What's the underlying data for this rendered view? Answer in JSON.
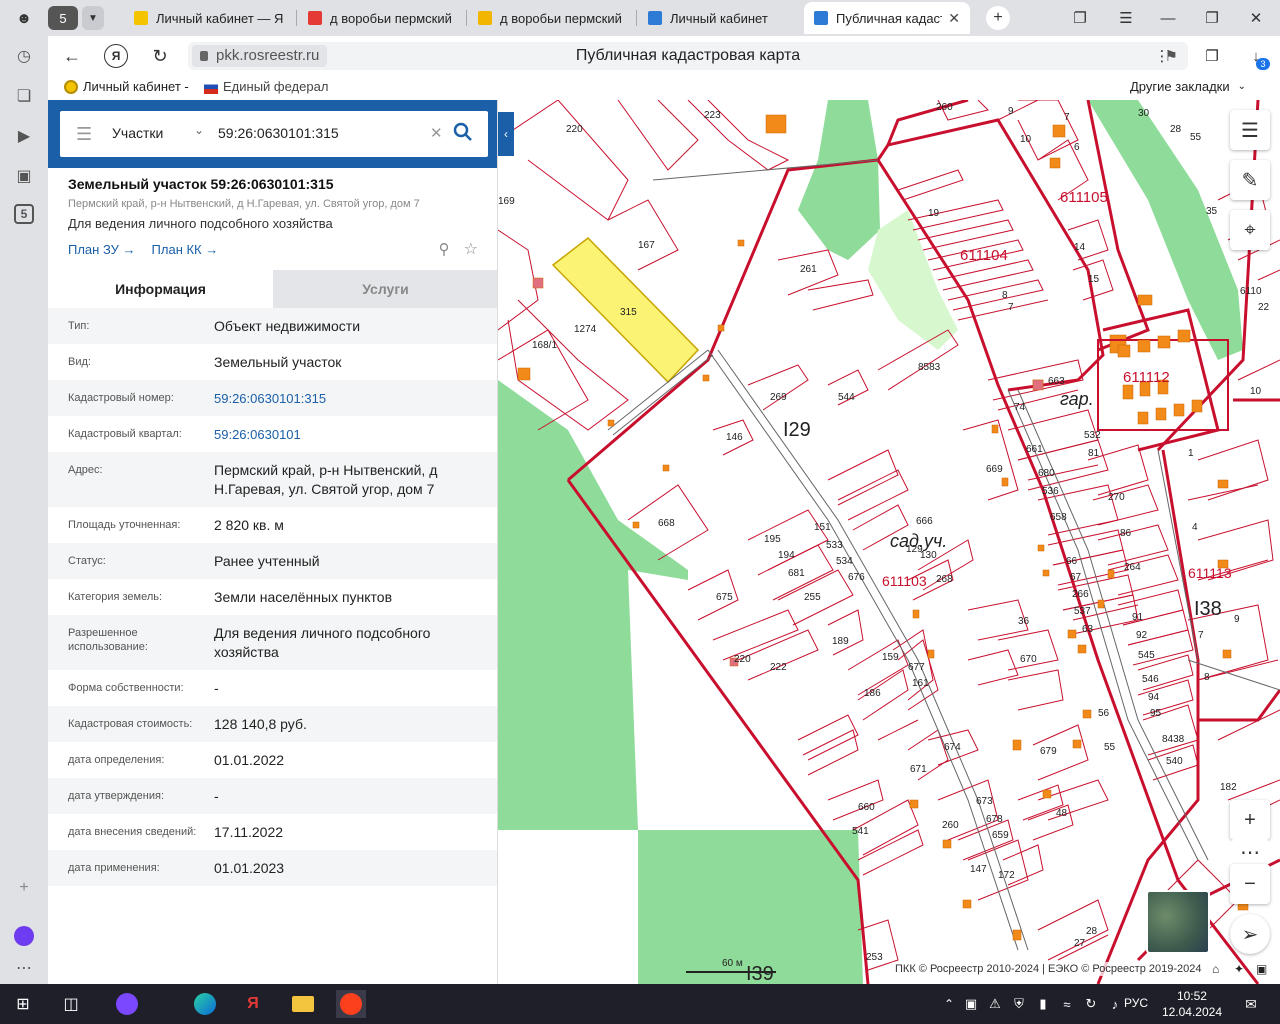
{
  "browser": {
    "tab_count_badge": "5",
    "tabs": [
      {
        "label": "Личный кабинет — Я",
        "color": "#f5c400"
      },
      {
        "label": "д воробьи пермский",
        "color": "#e53935"
      },
      {
        "label": "д воробьи пермский",
        "color": "#f2b600"
      },
      {
        "label": "Личный кабинет",
        "color": "#2e7bd6"
      },
      {
        "label": "Публичная кадаст",
        "color": "#2e7bd6"
      }
    ],
    "url": "pkk.rosreestr.ru",
    "page_title": "Публичная кадастровая карта",
    "downloads_badge": "3",
    "bookmarks": [
      {
        "label": "Личный кабинет -"
      },
      {
        "label": "Единый федерал"
      }
    ],
    "other_bookmarks": "Другие закладки",
    "rail_badge": "5"
  },
  "search": {
    "category": "Участки",
    "query": "59:26:0630101:315"
  },
  "card": {
    "title": "Земельный участок 59:26:0630101:315",
    "address": "Пермский край, р-н Нытвенский, д Н.Гаревая, ул. Святой угор, дом 7",
    "usage": "Для ведения личного подсобного хозяйства",
    "link_zu": "План ЗУ →",
    "link_kk": "План КК →"
  },
  "tabs": {
    "info": "Информация",
    "services": "Услуги"
  },
  "info_rows": [
    {
      "label": "Тип:",
      "value": "Объект недвижимости"
    },
    {
      "label": "Вид:",
      "value": "Земельный участок"
    },
    {
      "label": "Кадастровый номер:",
      "value": "59:26:0630101:315"
    },
    {
      "label": "Кадастровый квартал:",
      "value": "59:26:0630101"
    },
    {
      "label": "Адрес:",
      "value": "Пермский край, р-н Нытвенский, д Н.Гаревая, ул. Святой угор, дом 7"
    },
    {
      "label": "Площадь уточненная:",
      "value": "2 820 кв. м"
    },
    {
      "label": "Статус:",
      "value": "Ранее учтенный"
    },
    {
      "label": "Категория земель:",
      "value": "Земли населённых пунктов"
    },
    {
      "label": "Разрешенное использование:",
      "value": "Для ведения личного подсобного хозяйства"
    },
    {
      "label": "Форма собственности:",
      "value": "-"
    },
    {
      "label": "Кадастровая стоимость:",
      "value": "128 140,8 руб."
    },
    {
      "label": "дата определения:",
      "value": "01.01.2022"
    },
    {
      "label": "дата утверждения:",
      "value": "-"
    },
    {
      "label": "дата внесения сведений:",
      "value": "17.11.2022"
    },
    {
      "label": "дата применения:",
      "value": "01.01.2023"
    }
  ],
  "map": {
    "labels": {
      "q129": "I29",
      "q138": "I38",
      "q139": "I39",
      "b611105": "611105",
      "b611104": "611104",
      "b611112": "611112",
      "b611103": "611103",
      "b611113": "611113",
      "gar": "гар.",
      "sadyc": "сад.уч.",
      "p315": "315",
      "p1274": "1274",
      "p167": "167",
      "p220": "220",
      "p223": "223",
      "p261": "261",
      "p269": "269",
      "p146": "146",
      "p668": "668",
      "p675": "675",
      "p663": "663",
      "p661": "661",
      "p680": "680",
      "p536": "536",
      "p658": "658",
      "p670": "670",
      "p36": "36",
      "p91": "91",
      "p92": "92",
      "p545": "545",
      "p546": "546",
      "p8438": "8438",
      "p540": "540",
      "p182": "182",
      "p253": "253",
      "p669": "669",
      "p8583": "8583",
      "p544": "544",
      "p169": "169",
      "p260": "260",
      "p19": "19",
      "p14": "14",
      "p15": "15",
      "p1": "1",
      "p4": "4",
      "p9": "9",
      "p7": "7",
      "p8": "8",
      "p10": "10",
      "p6": "6",
      "p28": "28",
      "p55": "55",
      "p30": "30",
      "p270": "270",
      "p86": "86",
      "p264": "264",
      "p66": "66",
      "p67": "67",
      "p266": "266",
      "p537": "537",
      "p63": "63",
      "p56": "56",
      "p55b": "55",
      "p94": "94",
      "p95": "95",
      "p679": "679",
      "p48": "48",
      "p673": "673",
      "p678": "678",
      "p659": "659",
      "p172": "172",
      "p147": "147",
      "p260b": "260",
      "p660": "660",
      "p541": "541",
      "p671": "671",
      "p674": "674",
      "p186": "186",
      "p159": "159",
      "p677": "677",
      "p161": "161",
      "p189": "189",
      "p222": "222",
      "p220b": "220",
      "p255": "255",
      "p681": "681",
      "p194": "194",
      "p195": "195",
      "p151": "151",
      "p533": "533",
      "p534": "534",
      "p676": "676",
      "p666": "666",
      "p129": "129",
      "p130": "130",
      "p268": "268",
      "p74": "74",
      "p532": "532",
      "p81": "81",
      "p168": "168/1",
      "p27": "27",
      "p28b": "28",
      "p38": "38",
      "p1610": "6110",
      "p22": "22",
      "p35": "35",
      "p10b": "10"
    },
    "scale_label": "60 м",
    "copyright": "ПКК © Росреестр 2010-2024 | ЕЭКО © Росреестр 2019-2024",
    "colors": {
      "border": "#c8102e",
      "green": "#8fdc9a",
      "selected": "#fbf373",
      "building": "#f28a1a"
    }
  },
  "taskbar": {
    "lang": "РУС",
    "time": "10:52",
    "date": "12.04.2024"
  }
}
